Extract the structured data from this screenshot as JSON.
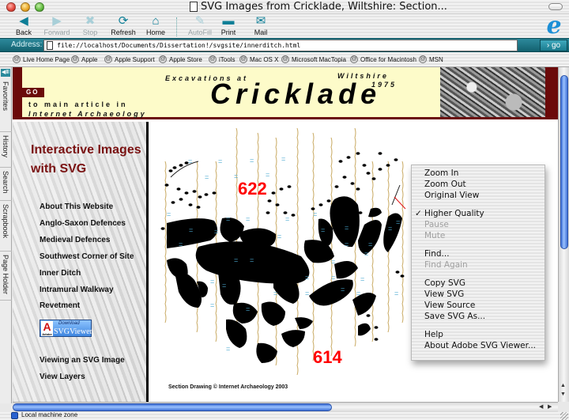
{
  "window": {
    "title": "SVG Images from Cricklade, Wiltshire: Section..."
  },
  "toolbar": {
    "buttons": [
      {
        "label": "Back",
        "icon": "back-arrow-icon",
        "enabled": true
      },
      {
        "label": "Forward",
        "icon": "forward-arrow-icon",
        "enabled": false
      },
      {
        "label": "Stop",
        "icon": "stop-x-icon",
        "enabled": false
      },
      {
        "label": "Refresh",
        "icon": "refresh-icon",
        "enabled": true
      },
      {
        "label": "Home",
        "icon": "home-icon",
        "enabled": true
      },
      {
        "label": "AutoFill",
        "icon": "autofill-icon",
        "enabled": false
      },
      {
        "label": "Print",
        "icon": "print-icon",
        "enabled": true
      },
      {
        "label": "Mail",
        "icon": "mail-icon",
        "enabled": true
      }
    ]
  },
  "address": {
    "label": "Address:",
    "value": "file://localhost/Documents/Dissertation!/svgsite/innerditch.html",
    "go_label": "› go"
  },
  "favorites": [
    "Live Home Page",
    "Apple",
    "Apple Support",
    "Apple Store",
    "iTools",
    "Mac OS X",
    "Microsoft MacTopia",
    "Office for Macintosh",
    "MSN"
  ],
  "side_tabs": [
    "Favorites",
    "History",
    "Search",
    "Scrapbook",
    "Page Holder"
  ],
  "banner": {
    "go_tag": "GO",
    "go_line1": "to main article in",
    "go_line2": "Internet Archaeology",
    "excavations_at": "Excavations at",
    "site": "Cricklade",
    "county": "Wiltshire",
    "year": "1975"
  },
  "leftnav": {
    "heading": "Interactive Images with SVG",
    "links": [
      "About This Website",
      "Anglo-Saxon Defences",
      "Medieval Defences",
      "Southwest Corner of Site",
      "Inner Ditch",
      "Intramural Walkway",
      "Revetment"
    ],
    "badge": {
      "adobe": "A",
      "adobe_small": "Adobe",
      "download": "Download",
      "name": "SVGViewer"
    },
    "links2": [
      "Viewing an SVG Image",
      "View Layers"
    ]
  },
  "drawing": {
    "labels": [
      "622",
      "614"
    ],
    "label_color": "#ff0000",
    "copyright": "Section Drawing © Internet Archaeology 2003"
  },
  "context_menu": {
    "groups": [
      [
        {
          "label": "Zoom In",
          "enabled": true
        },
        {
          "label": "Zoom Out",
          "enabled": true
        },
        {
          "label": "Original View",
          "enabled": true
        }
      ],
      [
        {
          "label": "Higher Quality",
          "enabled": true,
          "checked": true
        },
        {
          "label": "Pause",
          "enabled": false
        },
        {
          "label": "Mute",
          "enabled": false
        }
      ],
      [
        {
          "label": "Find...",
          "enabled": true
        },
        {
          "label": "Find Again",
          "enabled": false
        }
      ],
      [
        {
          "label": "Copy SVG",
          "enabled": true
        },
        {
          "label": "View SVG",
          "enabled": true
        },
        {
          "label": "View Source",
          "enabled": true
        },
        {
          "label": "Save SVG As...",
          "enabled": true
        }
      ],
      [
        {
          "label": "Help",
          "enabled": true
        },
        {
          "label": "About Adobe SVG Viewer...",
          "enabled": true
        }
      ]
    ]
  },
  "status": {
    "zone": "Local machine zone"
  },
  "colors": {
    "accent_teal": "#13616f",
    "banner_bg": "#fdfbc9",
    "banner_maroon": "#6b0a0a",
    "heading_red": "#7a1212"
  }
}
